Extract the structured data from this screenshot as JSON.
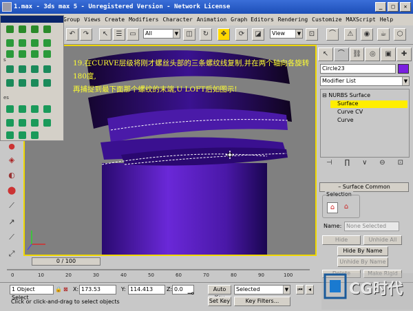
{
  "window": {
    "title": "1.max - 3ds max 5 - Unregistered Version - Network License"
  },
  "menu": [
    "Group",
    "Views",
    "Create",
    "Modifiers",
    "Character",
    "Animation",
    "Graph Editors",
    "Rendering",
    "Customize",
    "MAXScript",
    "Help"
  ],
  "toolbar": {
    "selection_filter": "All",
    "ref_coord": "View"
  },
  "viewport": {
    "annotation_line1": "19.在CURVE层级将刚才螺丝头部的三条螺纹线复制,并在两个轴向各旋转180度,",
    "annotation_line2": "再捕捉到最下面那个螺纹的末端,U LOFT后如图示!"
  },
  "float_panel": {
    "labels": [
      "s",
      "es"
    ]
  },
  "command_panel": {
    "object_name": "Circle23",
    "object_color": "#7a1ee0",
    "modifier_list": "Modifier List",
    "stack": {
      "root": "NURBS Surface",
      "items": [
        "Surface",
        "Curve CV",
        "Curve"
      ],
      "selected": "Surface"
    },
    "rollout_title": "Surface Common",
    "selection_label": "Selection",
    "name_label": "Name:",
    "name_value": "None Selected",
    "buttons": {
      "hide": "Hide",
      "unhide_all": "Unhide All",
      "hide_by_name": "Hide By Name",
      "unhide_by_name": "Unhide By Name",
      "delete": "Delete",
      "make_rigid": "Make Rigid"
    }
  },
  "timeline": {
    "frame": "0 / 100",
    "ticks": [
      "0",
      "10",
      "20",
      "30",
      "40",
      "50",
      "60",
      "70",
      "80",
      "90",
      "100"
    ]
  },
  "status": {
    "selection": "1 Object Select",
    "x_label": "X:",
    "x_value": "173.53",
    "y_label": "Y:",
    "y_value": "114.413",
    "z_label": "Z:",
    "z_value": "0.0",
    "auto_key": "Auto Key",
    "key_mode": "Selected",
    "set_key": "Set Key",
    "key_filters": "Key Filters...",
    "prompt": "Click or click-and-drag to select objects"
  },
  "logo": {
    "text": "CG时代"
  },
  "colors": {
    "object_purple": "#5a1ab8",
    "viewport_border": "#f0d800",
    "stack_highlight": "#ffee00"
  }
}
